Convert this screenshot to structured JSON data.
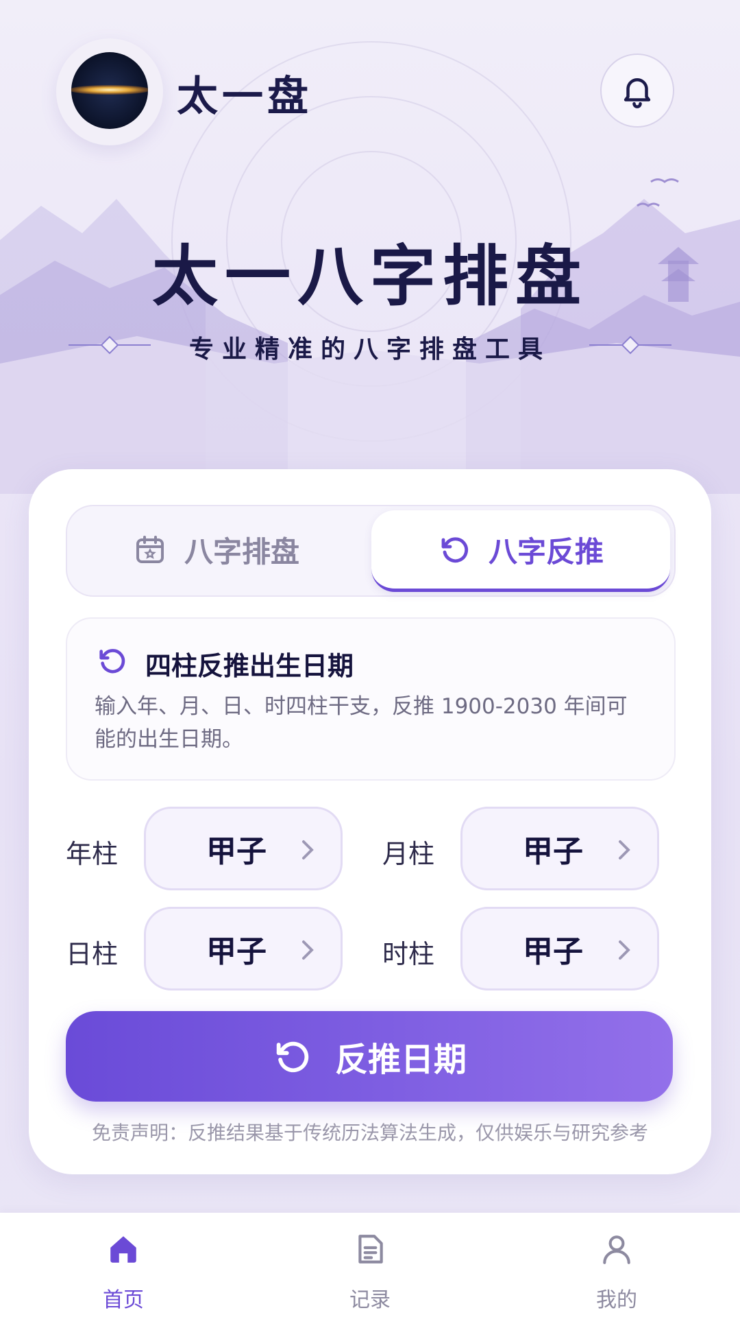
{
  "header": {
    "app_title": "太一盘"
  },
  "hero": {
    "title": "太一八字排盘",
    "subtitle": "专业精准的八字排盘工具"
  },
  "tabs": [
    {
      "label": "八字排盘",
      "icon": "calendar-icon",
      "active": false
    },
    {
      "label": "八字反推",
      "icon": "rotate-ccw-icon",
      "active": true
    }
  ],
  "info": {
    "title": "四柱反推出生日期",
    "description": "输入年、月、日、时四柱干支，反推 1900-2030 年间可能的出生日期。"
  },
  "pillars": [
    {
      "label": "年柱",
      "value": "甲子"
    },
    {
      "label": "月柱",
      "value": "甲子"
    },
    {
      "label": "日柱",
      "value": "甲子"
    },
    {
      "label": "时柱",
      "value": "甲子"
    }
  ],
  "submit_label": "反推日期",
  "disclaimer": "免责声明：反推结果基于传统历法算法生成，仅供娱乐与研究参考",
  "nav": [
    {
      "label": "首页",
      "icon": "home-icon",
      "active": true
    },
    {
      "label": "记录",
      "icon": "document-icon",
      "active": false
    },
    {
      "label": "我的",
      "icon": "user-icon",
      "active": false
    }
  ],
  "colors": {
    "accent": "#6b4ad6",
    "title": "#1a1947"
  }
}
